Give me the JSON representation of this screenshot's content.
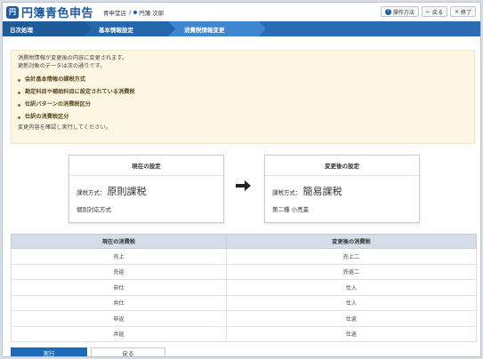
{
  "app": {
    "logo_mark": "円",
    "title": "円簿青色申告",
    "office": "青申堂店",
    "separator": "/",
    "user": "円簿 次郎"
  },
  "toolbar": {
    "help_label": "操作方法",
    "back_label": "戻る",
    "close_label": "終了"
  },
  "breadcrumb": {
    "items": [
      {
        "label": "日次処理"
      },
      {
        "label": "基本情報設定"
      },
      {
        "label": "消費税情報変更"
      }
    ]
  },
  "notice": {
    "line1": "消費税情報が変更後の内容に変更されます。",
    "line2": "更新対象のデータは次の通りです。",
    "items": [
      {
        "label": "会計基本情報の課税方式"
      },
      {
        "label": "勘定科目や補助科目に設定されている消費税"
      },
      {
        "label": "仕訳パターンの消費税区分"
      },
      {
        "label": "仕訳の消費税区分"
      }
    ],
    "footer": "変更内容を確認し実行してください。"
  },
  "current_setting": {
    "heading": "現在の設定",
    "method_label": "課税方式：",
    "method_value": "原則課税",
    "sub_value": "個別対応方式"
  },
  "new_setting": {
    "heading": "変更後の設定",
    "method_label": "課税方式：",
    "method_value": "簡易課税",
    "sub_value": "第二種 小売業"
  },
  "tax_table": {
    "headers": [
      "現在の消費税",
      "変更後の消費税"
    ],
    "rows": [
      [
        "売上",
        "売上二"
      ],
      [
        "売返",
        "売返二"
      ],
      [
        "非仕",
        "仕入"
      ],
      [
        "共仕",
        "仕入"
      ],
      [
        "非返",
        "仕返"
      ],
      [
        "共返",
        "仕返"
      ]
    ]
  },
  "actions": {
    "run_label": "実行",
    "back_label": "戻る"
  },
  "colors": {
    "brand": "#1d5aa6",
    "breadcrumb": "#2a6cb3",
    "notice_bg": "#fdf6e3",
    "table_header": "#d5dee8",
    "run_button": "#1d6ab8"
  }
}
